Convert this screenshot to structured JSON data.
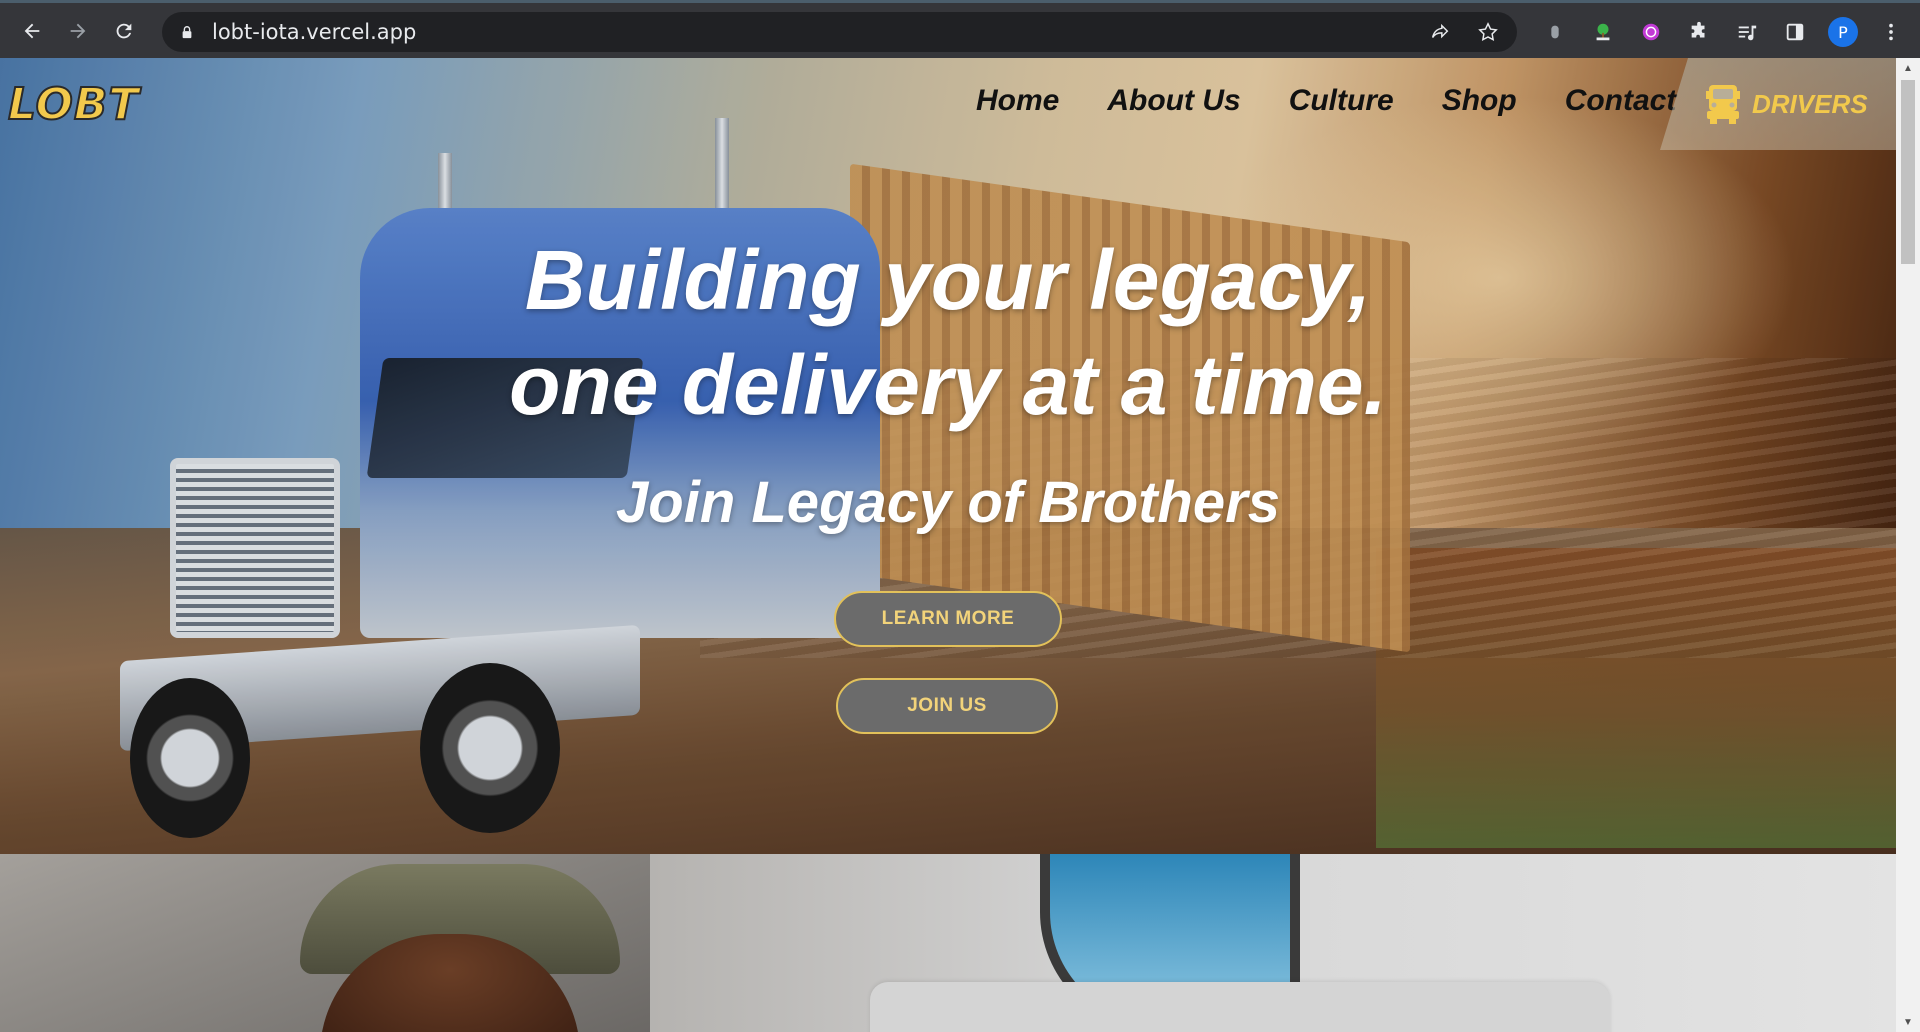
{
  "browser": {
    "url": "lobt-iota.vercel.app",
    "profile_initial": "P"
  },
  "site": {
    "logo_text": "LOBT",
    "nav": [
      "Home",
      "About Us",
      "Culture",
      "Shop",
      "Contact"
    ],
    "drivers_label": "DRIVERS"
  },
  "hero": {
    "headline_line1": "Building your legacy,",
    "headline_line2": "one delivery at a time.",
    "subheadline": "Join Legacy of Brothers",
    "learn_more": "LEARN MORE",
    "join_us": "JOIN US"
  },
  "colors": {
    "accent": "#f2c94c",
    "button_bg": "#6b6b6b",
    "chrome_bg": "#35363a"
  }
}
